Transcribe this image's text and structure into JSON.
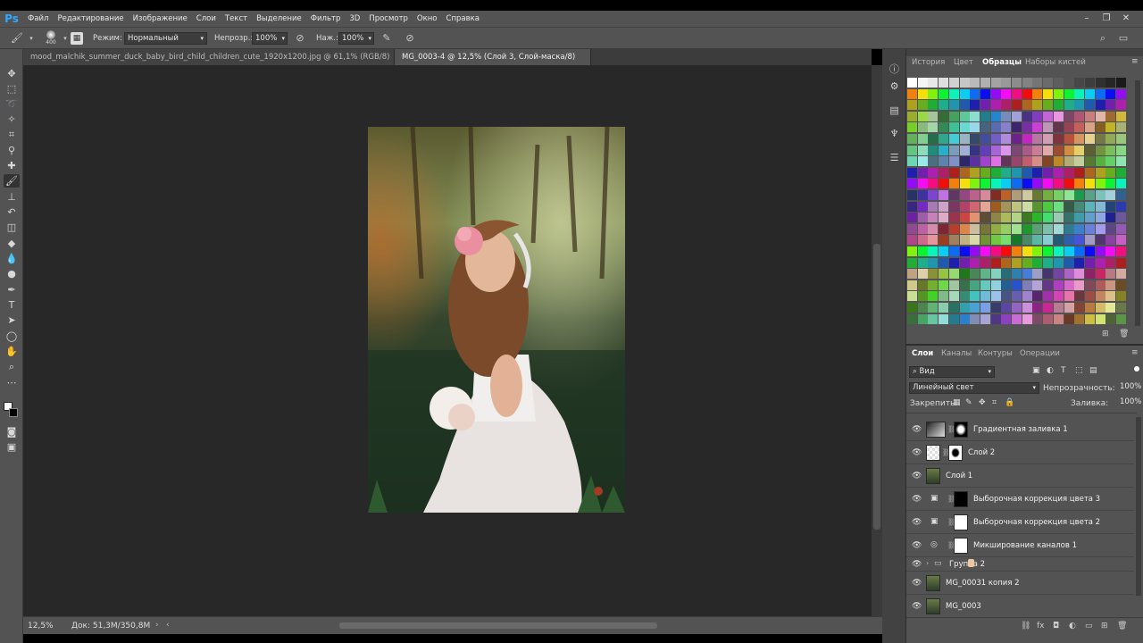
{
  "app": {
    "logo": "Ps"
  },
  "menu": [
    "Файл",
    "Редактирование",
    "Изображение",
    "Слои",
    "Текст",
    "Выделение",
    "Фильтр",
    "3D",
    "Просмотр",
    "Окно",
    "Справка"
  ],
  "options": {
    "brush_size": "400",
    "mode_label": "Режим:",
    "mode_value": "Нормальный",
    "opacity_label": "Непрозр.:",
    "opacity_value": "100%",
    "flow_label": "Наж.:",
    "flow_value": "100%"
  },
  "tabs": [
    {
      "label": "mood_malchik_summer_duck_baby_bird_child_children_cute_1920x1200.jpg @ 61,1% (RGB/8) *",
      "close": "×"
    },
    {
      "label": "MG_0003-4 @ 12,5% (Слой 3, Слой-маска/8) *",
      "close": "×"
    }
  ],
  "status": {
    "zoom": "12,5%",
    "doc": "Док: 51,3M/350,8M"
  },
  "swatches_panel": {
    "tabs": [
      "История",
      "Цвет",
      "Образцы",
      "Наборы кистей"
    ],
    "active": "Образцы"
  },
  "layers_panel": {
    "tabs": [
      "Слои",
      "Каналы",
      "Контуры",
      "Операции"
    ],
    "filter": "Вид",
    "blend_mode": "Линейный свет",
    "opacity_label": "Непрозрачность:",
    "opacity_value": "100%",
    "lock_label": "Закрепить:",
    "fill_label": "Заливка:",
    "fill_value": "100%",
    "layers": [
      {
        "name": "Градиентная заливка 1"
      },
      {
        "name": "Слой 2"
      },
      {
        "name": "Слой 1"
      },
      {
        "name": "Выборочная коррекция цвета 3"
      },
      {
        "name": "Выборочная коррекция цвета 2"
      },
      {
        "name": "Микширование каналов 1"
      },
      {
        "name": "Группа 2"
      },
      {
        "name": "MG_00031 копия 2"
      },
      {
        "name": "MG_0003"
      }
    ]
  }
}
